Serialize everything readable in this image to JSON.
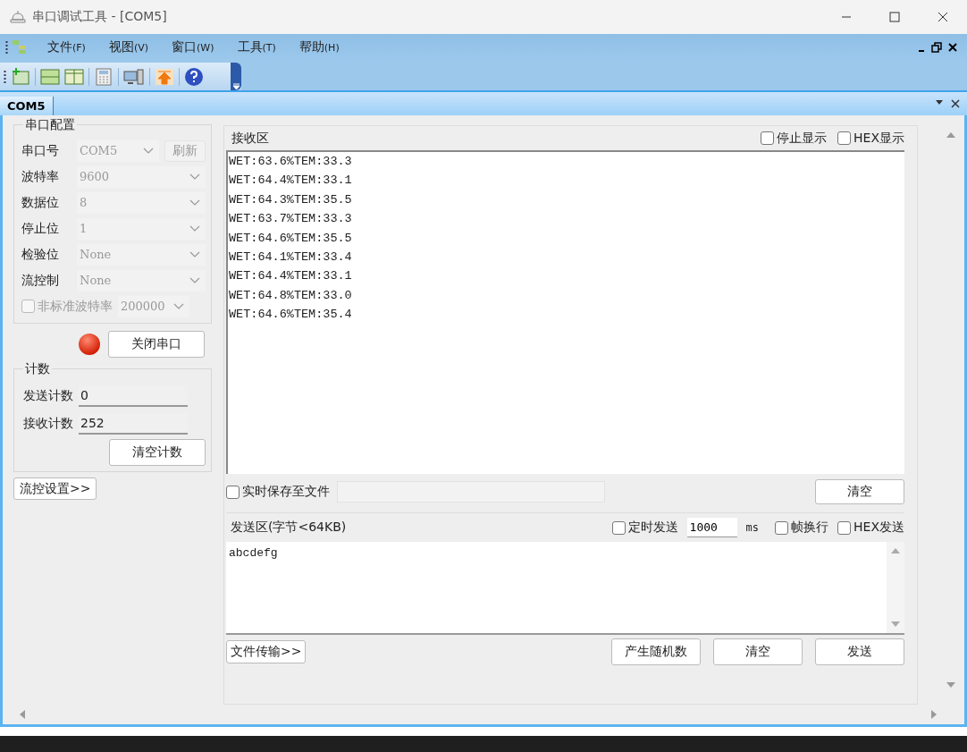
{
  "window": {
    "title": "串口调试工具 - [COM5]"
  },
  "menu": {
    "items": [
      {
        "label": "文件",
        "key": "(F)"
      },
      {
        "label": "视图",
        "key": "(V)"
      },
      {
        "label": "窗口",
        "key": "(W)"
      },
      {
        "label": "工具",
        "key": "(T)"
      },
      {
        "label": "帮助",
        "key": "(H)"
      }
    ]
  },
  "tabs": [
    {
      "label": "COM5",
      "selected": true
    }
  ],
  "serial_config": {
    "title": "串口配置",
    "fields": [
      {
        "label": "串口号",
        "value": "COM5",
        "disabled": true
      },
      {
        "label": "波特率",
        "value": "9600",
        "disabled": true
      },
      {
        "label": "数据位",
        "value": "8",
        "disabled": true
      },
      {
        "label": "停止位",
        "value": "1",
        "disabled": true
      },
      {
        "label": "检验位",
        "value": "None",
        "disabled": true
      },
      {
        "label": "流控制",
        "value": "None",
        "disabled": true
      }
    ],
    "refresh_button": {
      "label": "刷新",
      "disabled": true
    },
    "nonstandard": {
      "label": "非标准波特率",
      "checked": false,
      "disabled": true,
      "value": "200000"
    },
    "port_open": true,
    "close_button": "关闭串口"
  },
  "counts": {
    "title": "计数",
    "rows": [
      {
        "label": "发送计数",
        "value": "0"
      },
      {
        "label": "接收计数",
        "value": "252"
      }
    ],
    "clear_button": "清空计数"
  },
  "flow_button": "流控设置>>",
  "receive": {
    "title": "接收区",
    "options": [
      {
        "label": "停止显示",
        "checked": false
      },
      {
        "label": "HEX显示",
        "checked": false
      }
    ],
    "lines": [
      "WET:63.6%TEM:33.3",
      "WET:64.4%TEM:33.1",
      "WET:64.3%TEM:35.5",
      "WET:63.7%TEM:33.3",
      "WET:64.6%TEM:35.5",
      "WET:64.1%TEM:33.4",
      "WET:64.4%TEM:33.1",
      "WET:64.8%TEM:33.0",
      "WET:64.6%TEM:35.4"
    ],
    "save_to_file": {
      "label": "实时保存至文件",
      "checked": false
    },
    "clear_button": "清空"
  },
  "send": {
    "title": "发送区(字节<64KB)",
    "timed": {
      "label": "定时发送",
      "checked": false,
      "interval": "1000",
      "unit": "ms"
    },
    "options": [
      {
        "label": "帧换行",
        "checked": false
      },
      {
        "label": "HEX发送",
        "checked": false
      }
    ],
    "text": "abcdefg",
    "buttons": [
      "文件传输>>",
      "产生随机数",
      "清空",
      "发送"
    ]
  }
}
